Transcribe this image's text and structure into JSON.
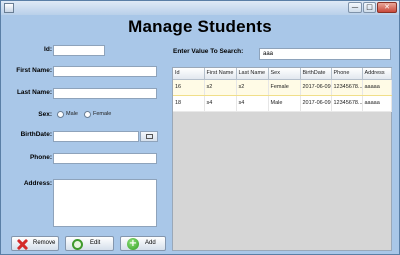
{
  "window": {
    "minimize_glyph": "—",
    "maximize_glyph": "□",
    "close_glyph": "✕"
  },
  "page": {
    "title": "Manage Students"
  },
  "form": {
    "id_label": "Id:",
    "first_name_label": "First Name:",
    "last_name_label": "Last Name:",
    "sex_label": "Sex:",
    "male_label": "Male",
    "female_label": "Female",
    "birthdate_label": "BirthDate:",
    "phone_label": "Phone:",
    "address_label": "Address:",
    "id_value": "",
    "first_name_value": "",
    "last_name_value": "",
    "birthdate_value": "",
    "phone_value": "",
    "address_value": ""
  },
  "buttons": {
    "remove": "Remove",
    "edit": "Edit",
    "add": "Add"
  },
  "search": {
    "label": "Enter Value To Search:",
    "value": "aaa"
  },
  "table": {
    "columns": [
      "Id",
      "First Name",
      "Last Name",
      "Sex",
      "BirthDate",
      "Phone",
      "Address"
    ],
    "rows": [
      [
        "16",
        "s2",
        "s2",
        "Female",
        "2017-06-09",
        "12345678...",
        "aaaaa"
      ],
      [
        "18",
        "s4",
        "s4",
        "Male",
        "2017-06-09",
        "12345678...",
        "aaaaa"
      ]
    ]
  }
}
